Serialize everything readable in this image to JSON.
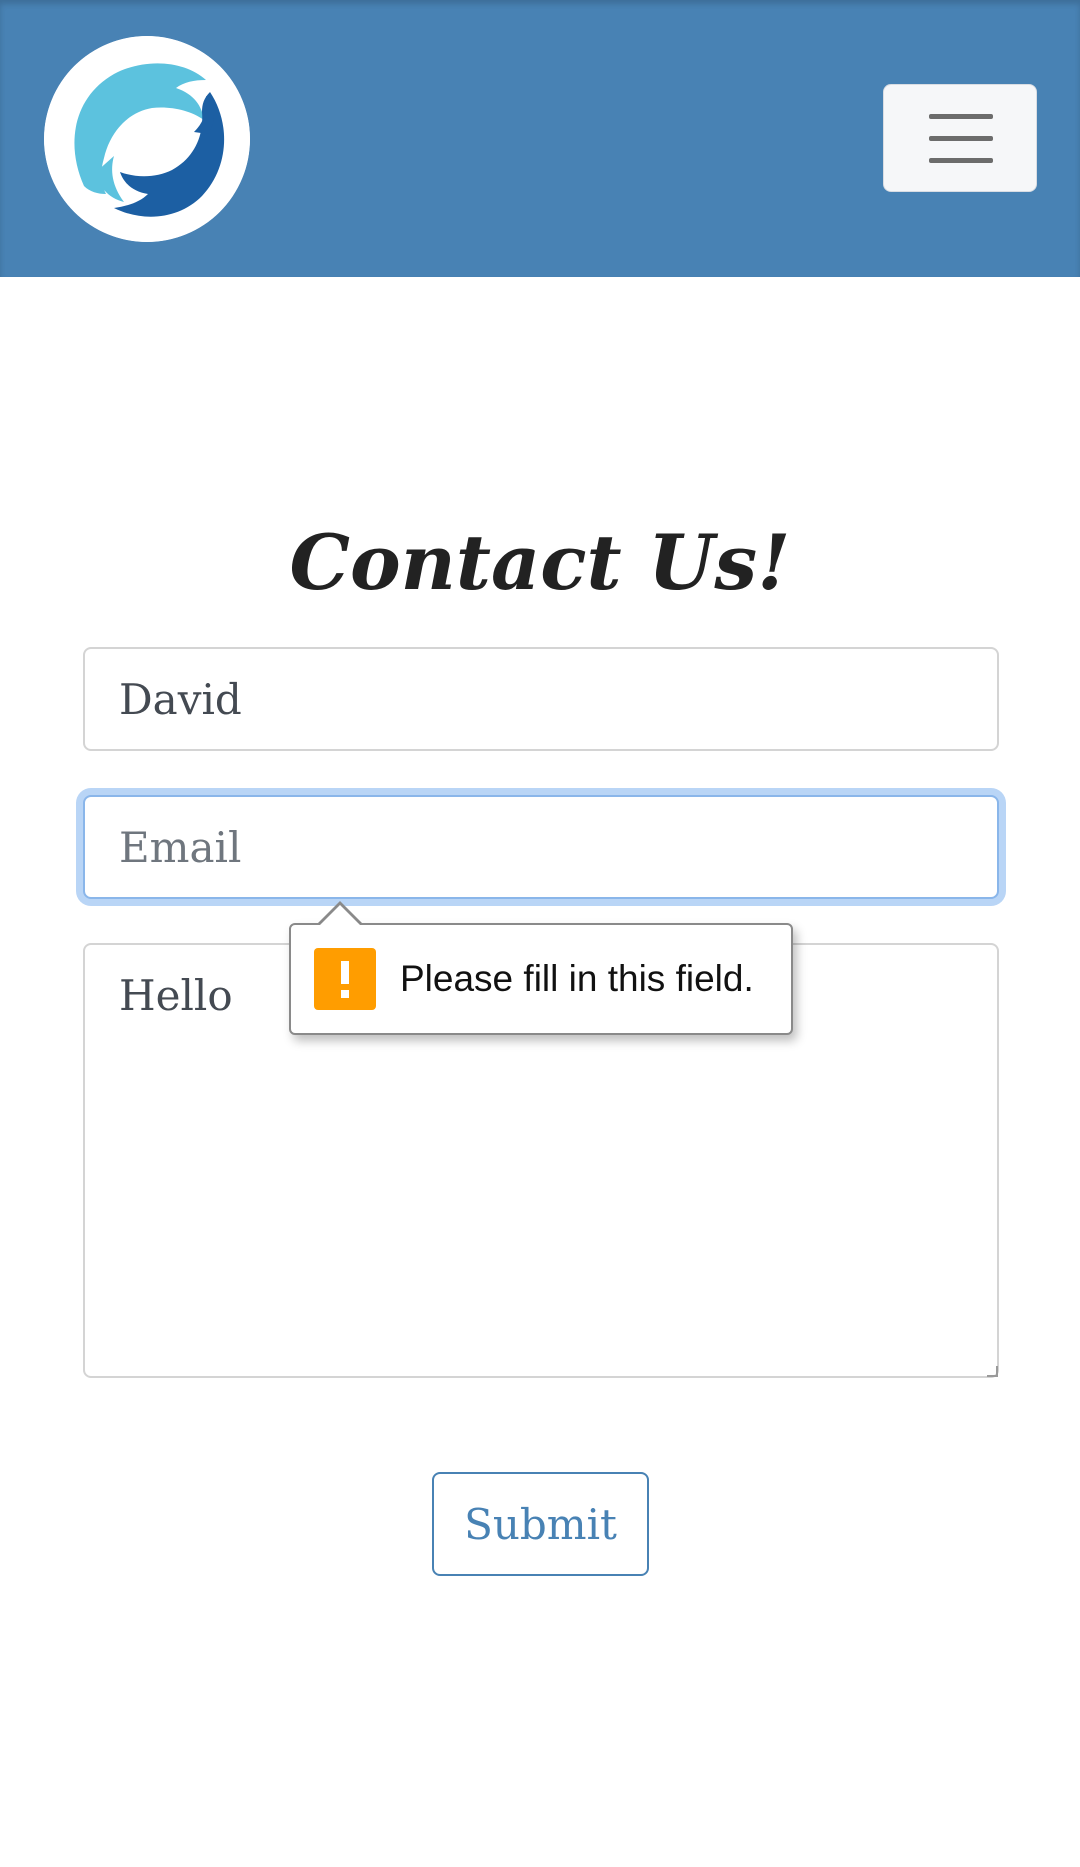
{
  "header": {
    "logo_icon": "dolphins-logo-icon",
    "menu_icon": "hamburger-menu-icon",
    "background_color": "#4882b4"
  },
  "main": {
    "title": "Contact Us!",
    "form": {
      "name": {
        "value": "David",
        "placeholder": ""
      },
      "email": {
        "value": "",
        "placeholder": "Email"
      },
      "message": {
        "value": "Hello",
        "placeholder": ""
      },
      "submit_label": "Submit"
    },
    "validation_tooltip": {
      "icon": "warning-icon",
      "message": "Please fill in this field.",
      "icon_color": "#ff9d00"
    }
  },
  "colors": {
    "accent": "#4882b4",
    "focus_ring": "#b9d5f6"
  }
}
